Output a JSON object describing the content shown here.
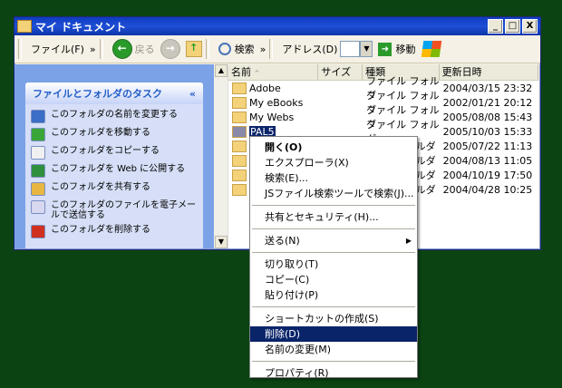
{
  "window": {
    "title": "マイ ドキュメント",
    "buttons": [
      "_",
      "□",
      "X"
    ]
  },
  "toolbar": {
    "file_label": "ファイル(F)",
    "chevron": "»",
    "back_label": "戻る",
    "search_label": "検索",
    "address_label": "アドレス(D)",
    "go_label": "移動"
  },
  "tasks": {
    "header": "ファイルとフォルダのタスク",
    "collapse": "«",
    "items": [
      {
        "label": "このフォルダの名前を変更する",
        "color": "#3a6ec7"
      },
      {
        "label": "このフォルダを移動する",
        "color": "#3aa63a"
      },
      {
        "label": "このフォルダをコピーする",
        "color": "#f0f0f0"
      },
      {
        "label": "このフォルダを Web に公開する",
        "color": "#2f8f3f"
      },
      {
        "label": "このフォルダを共有する",
        "color": "#e8b742"
      },
      {
        "label": "このフォルダのファイルを電子メールで送信する",
        "color": "#d8d8f0"
      },
      {
        "label": "このフォルダを削除する",
        "color": "#d03020"
      }
    ]
  },
  "list": {
    "columns": [
      "名前",
      "サイズ",
      "種類",
      "更新日時"
    ],
    "sort_indicator": "^",
    "rows": [
      {
        "name": "Adobe",
        "type": "ファイル フォルダ",
        "date": "2004/03/15 23:32"
      },
      {
        "name": "My eBooks",
        "type": "ファイル フォルダ",
        "date": "2002/01/21 20:12"
      },
      {
        "name": "My Webs",
        "type": "ファイル フォルダ",
        "date": "2005/08/08 15:43"
      },
      {
        "name": "PAL5",
        "type": "ファイル フォルダ",
        "date": "2005/10/03 15:33"
      },
      {
        "name": "",
        "type": "ルダ",
        "date": "2005/07/22 11:13"
      },
      {
        "name": "",
        "type": "ルダ",
        "date": "2004/08/13 11:05"
      },
      {
        "name": "",
        "type": "ルダ",
        "date": "2004/10/19 17:50"
      },
      {
        "name": "",
        "type": "ルダ",
        "date": "2004/04/28 10:25"
      }
    ]
  },
  "context_menu": {
    "items": [
      {
        "label": "開く(O)",
        "bold": true
      },
      {
        "label": "エクスプローラ(X)"
      },
      {
        "label": "検索(E)..."
      },
      {
        "label": "JSファイル検索ツールで検索(J)..."
      },
      {
        "sep": true
      },
      {
        "label": "共有とセキュリティ(H)..."
      },
      {
        "sep": true
      },
      {
        "label": "送る(N)",
        "submenu": "▶"
      },
      {
        "sep": true
      },
      {
        "label": "切り取り(T)"
      },
      {
        "label": "コピー(C)"
      },
      {
        "label": "貼り付け(P)"
      },
      {
        "sep": true
      },
      {
        "label": "ショートカットの作成(S)"
      },
      {
        "label": "削除(D)",
        "highlighted": true
      },
      {
        "label": "名前の変更(M)"
      },
      {
        "sep": true
      },
      {
        "label": "プロパティ(R)"
      }
    ]
  }
}
